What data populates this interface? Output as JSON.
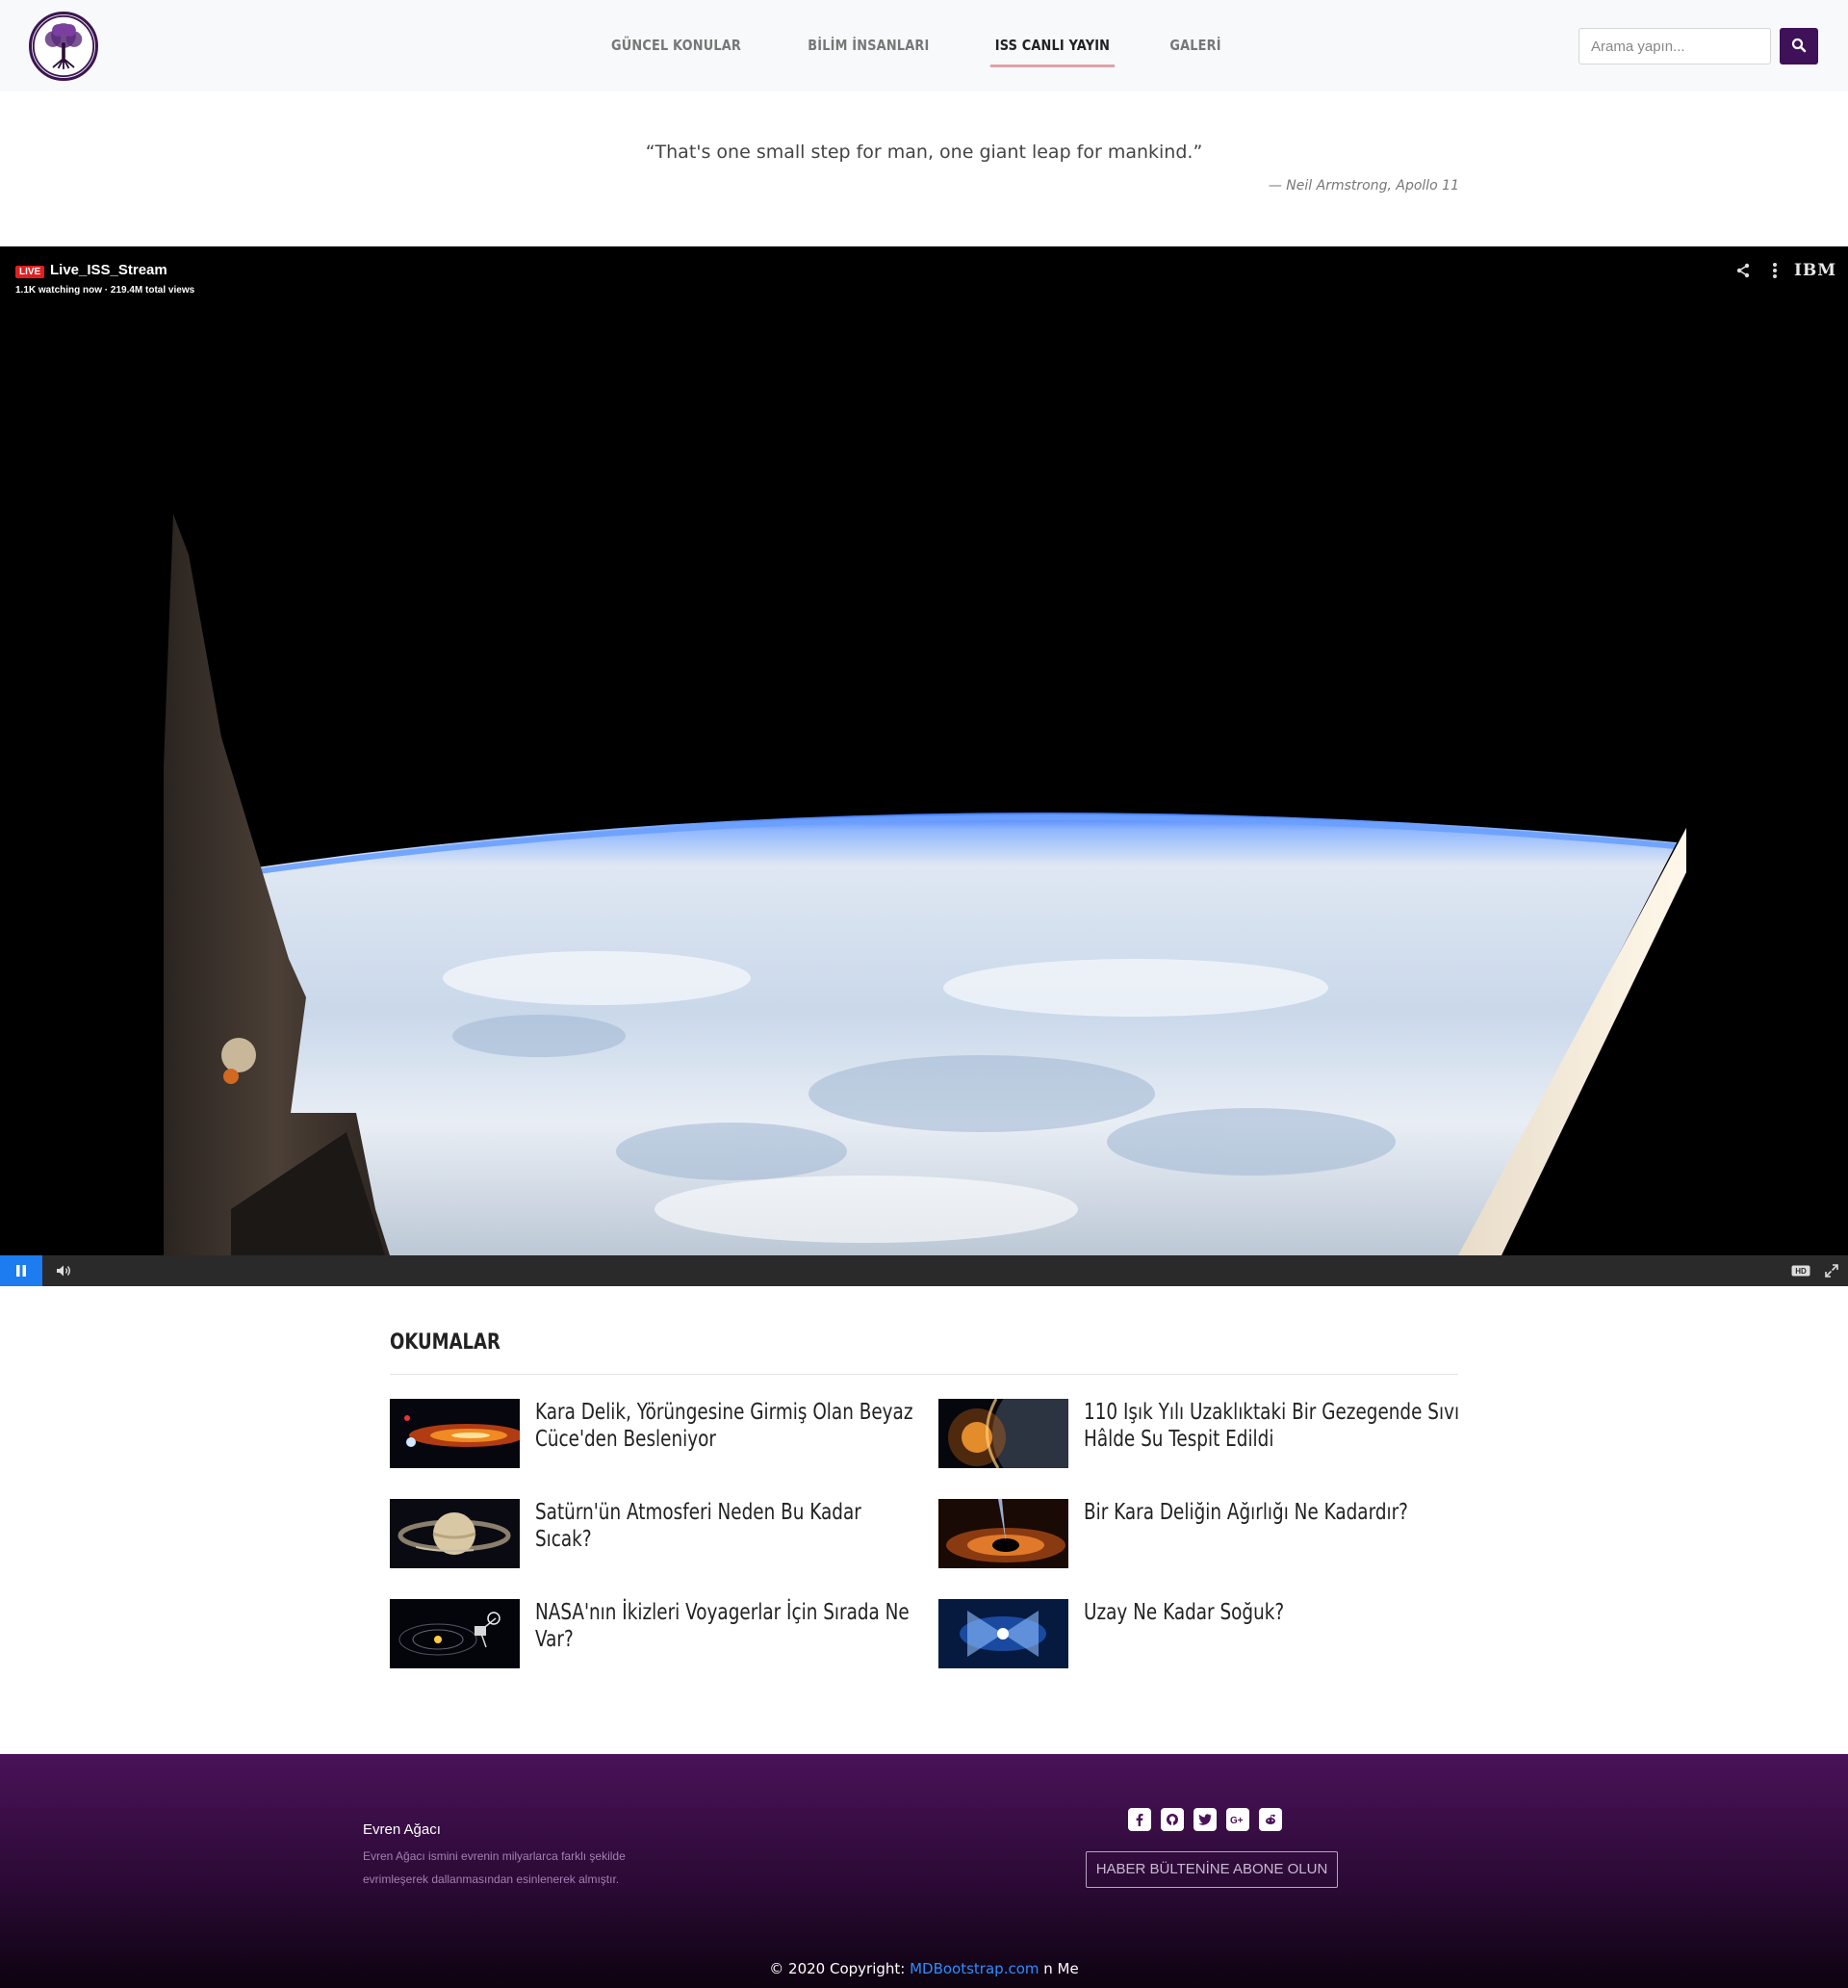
{
  "nav": {
    "links": [
      "GÜNCEL KONULAR",
      "BİLİM İNSANLARI",
      "ISS CANLI YAYIN",
      "GALERİ"
    ],
    "active_index": 2,
    "search_placeholder": "Arama yapın...",
    "icons": {
      "logo": "tree-of-life-logo",
      "search": "search-icon"
    }
  },
  "quote": {
    "text": "“That's one small step for man, one giant leap for mankind.”",
    "author": "— Neil Armstrong, Apollo 11"
  },
  "player": {
    "live_label": "LIVE",
    "title": "Live_ISS_Stream",
    "stats": "1.1K watching now · 219.4M total views",
    "brand": "IBM",
    "hd_label": "HD",
    "icons": [
      "share-icon",
      "more-vertical-icon",
      "pause-icon",
      "volume-icon",
      "hd-icon",
      "fullscreen-icon"
    ],
    "accent_color": "#1c7cf0"
  },
  "reading": {
    "title": "OKUMALAR",
    "articles": [
      {
        "title": "Kara Delik, Yörüngesine Girmiş Olan Beyaz Cüce'den Besleniyor"
      },
      {
        "title": "110 Işık Yılı Uzaklıktaki Bir Gezegende Sıvı Hâlde Su Tespit Edildi"
      },
      {
        "title": "Satürn'ün Atmosferi Neden Bu Kadar Sıcak?"
      },
      {
        "title": "Bir Kara Deliğin Ağırlığı Ne Kadardır?"
      },
      {
        "title": "NASA'nın İkizleri Voyagerlar İçin Sırada Ne Var?"
      },
      {
        "title": "Uzay Ne Kadar Soğuk?"
      }
    ]
  },
  "footer": {
    "brand": "Evren Ağacı",
    "description": "Evren Ağacı ismini evrenin milyarlarca farklı şekilde evrimleşerek dallanmasından esinlenerek almıştır.",
    "socials": [
      "facebook-icon",
      "github-icon",
      "twitter-icon",
      "google-plus-icon",
      "reddit-icon"
    ],
    "subscribe": "HABER BÜLTENİNE ABONE OLUN",
    "copyright_prefix": "© 2020 Copyright: ",
    "copyright_link": "MDBootstrap.com",
    "copyright_suffix": " n Me",
    "brand_color": "#3f1158"
  }
}
